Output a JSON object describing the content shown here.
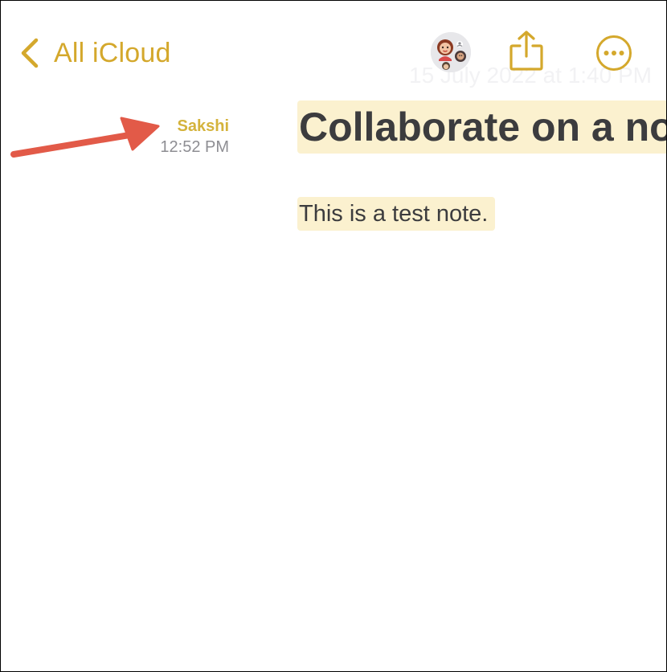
{
  "nav": {
    "back_label": "All iCloud"
  },
  "note": {
    "faded_date": "15 July 2022 at 1:40 PM",
    "title": "Collaborate on a note",
    "body": "This is a test note."
  },
  "highlight": {
    "author": "Sakshi",
    "time": "12:52 PM"
  },
  "icons": {
    "back": "chevron-left-icon",
    "collaborators": "collaborator-avatars-icon",
    "share": "share-icon",
    "more": "ellipsis-circle-icon",
    "annotation": "arrow-annotation"
  },
  "colors": {
    "accent": "#d4a82c",
    "author": "#d4b33c",
    "highlight": "#fbf1cf",
    "arrow": "#e25a48",
    "text": "#3c3c3e",
    "secondary": "#8e8e93"
  }
}
